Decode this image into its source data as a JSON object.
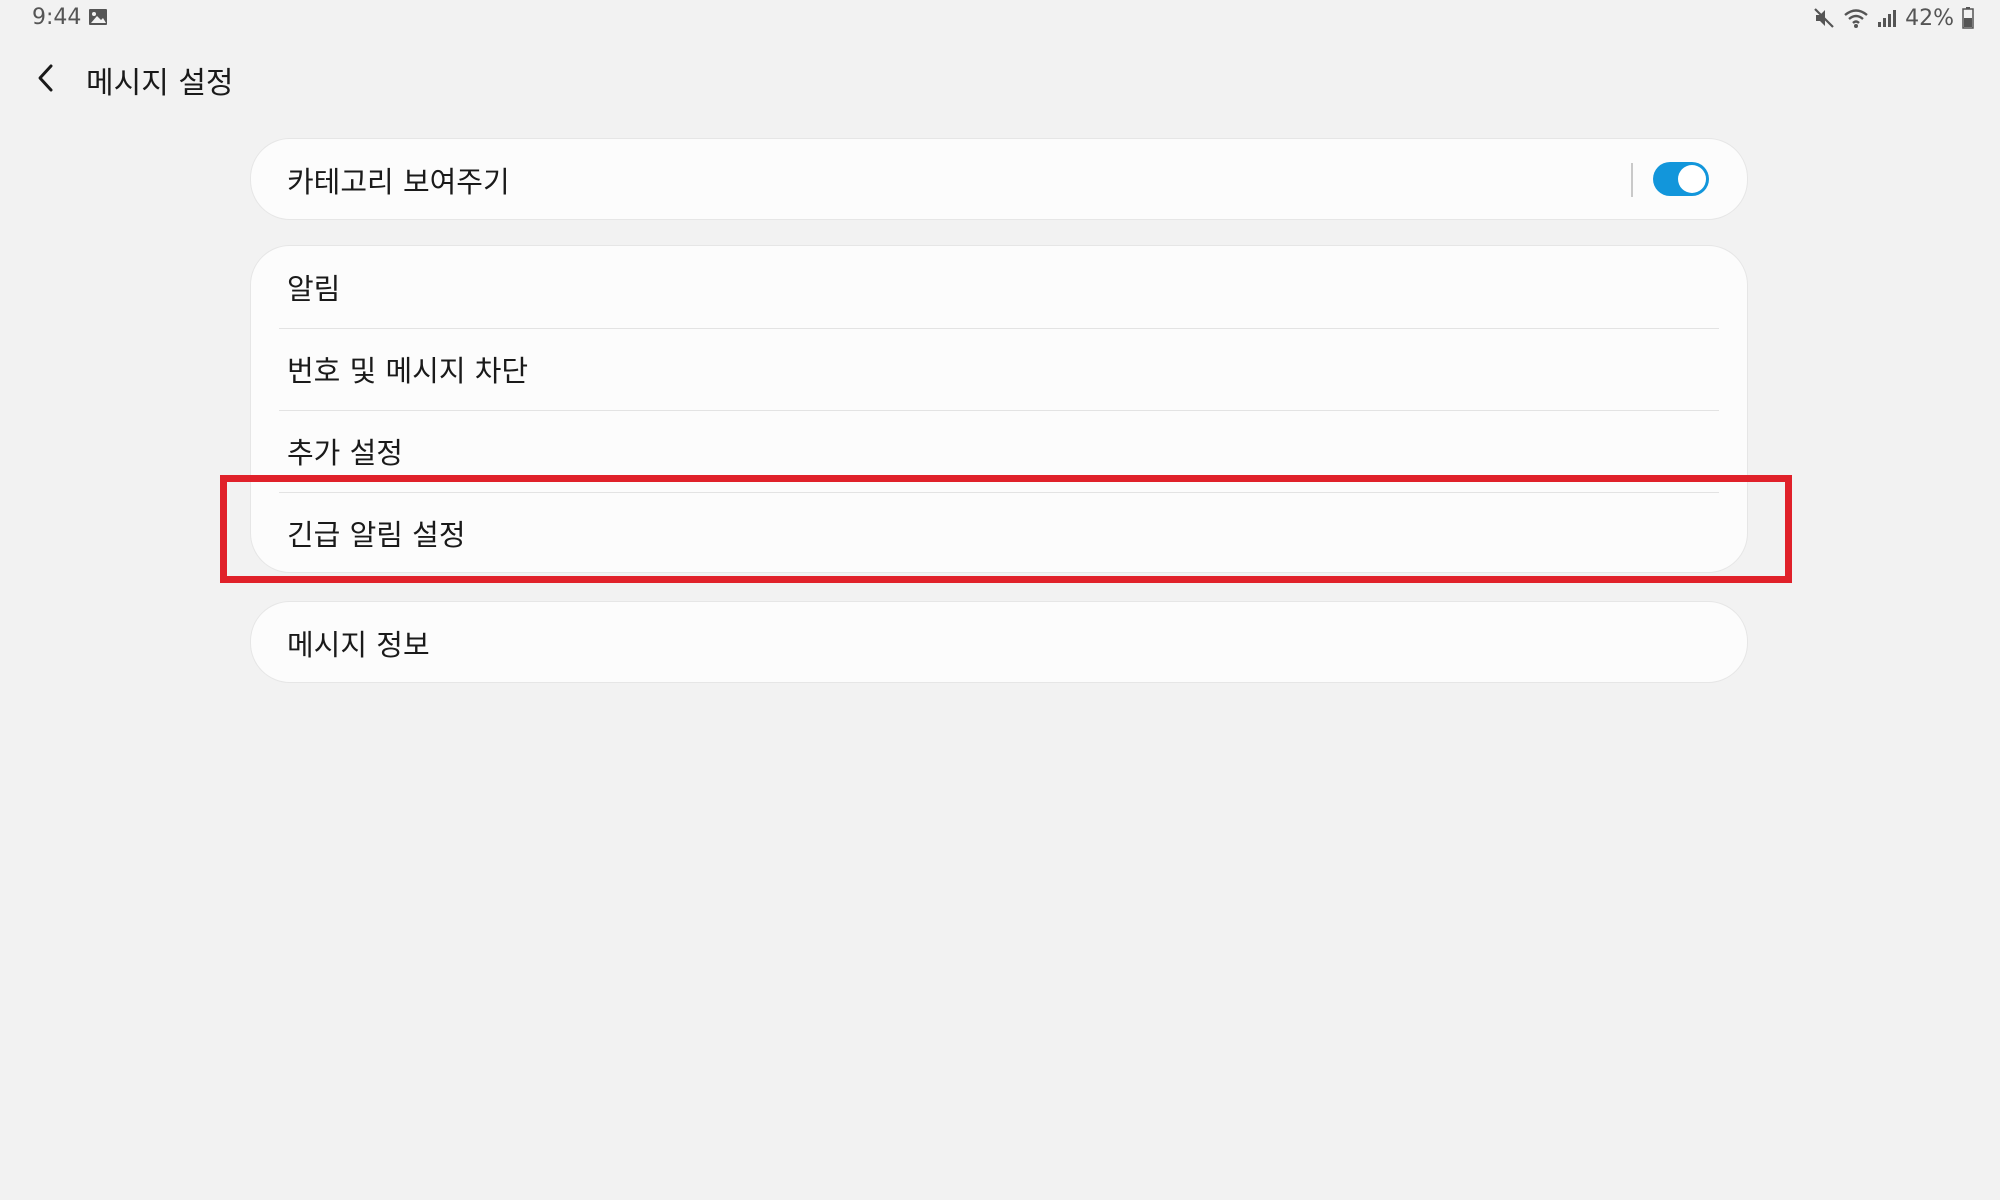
{
  "status_bar": {
    "time": "9:44",
    "battery": "42%",
    "icons": [
      "gallery-icon",
      "mute-icon",
      "wifi-icon",
      "signal-icon",
      "battery-icon"
    ]
  },
  "app_bar": {
    "title": "메시지 설정",
    "back_icon": "chevron-left-icon"
  },
  "sections": {
    "categories": {
      "label": "카테고리 보여주기",
      "toggle_on": true,
      "toggle_color": "#1296db"
    },
    "main": {
      "items": [
        {
          "label": "알림"
        },
        {
          "label": "번호 및 메시지 차단"
        },
        {
          "label": "추가 설정"
        },
        {
          "label": "긴급 알림 설정"
        }
      ]
    },
    "info": {
      "label": "메시지 정보"
    }
  },
  "highlight": {
    "target": "긴급 알림 설정",
    "color": "#e0212a"
  }
}
